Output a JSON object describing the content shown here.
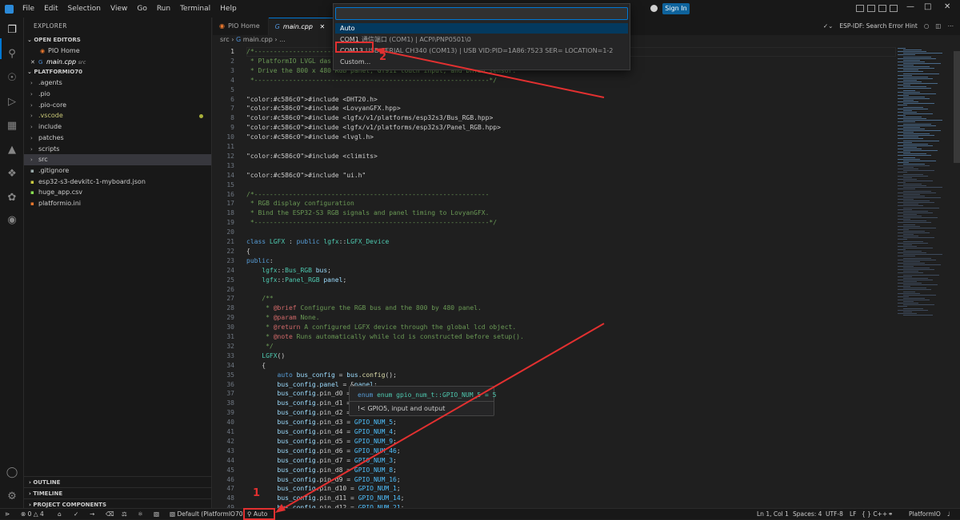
{
  "menu": [
    "File",
    "Edit",
    "Selection",
    "View",
    "Go",
    "Run",
    "Terminal",
    "Help"
  ],
  "signin_label": "Sign In",
  "activity_icons": [
    "files-icon",
    "search-icon",
    "source-control-icon",
    "run-debug-icon",
    "extensions-icon",
    "testing-icon",
    "python-icon",
    "remote-icon",
    "platformio-icon"
  ],
  "explorer": {
    "title": "EXPLORER",
    "open_editors": "OPEN EDITORS",
    "open_files": [
      {
        "name": "PIO Home",
        "note": ""
      },
      {
        "name": "main.cpp",
        "note": "src"
      }
    ],
    "project": "PLATFORMIO70",
    "tree": [
      {
        "name": ".agents",
        "kind": "folder"
      },
      {
        "name": ".pio",
        "kind": "folder"
      },
      {
        "name": ".pio-core",
        "kind": "folder"
      },
      {
        "name": ".vscode",
        "kind": "folder"
      },
      {
        "name": "include",
        "kind": "folder"
      },
      {
        "name": "patches",
        "kind": "folder"
      },
      {
        "name": "scripts",
        "kind": "folder"
      },
      {
        "name": "src",
        "kind": "folder"
      },
      {
        "name": ".gitignore",
        "kind": "file"
      },
      {
        "name": "esp32-s3-devkitc-1-myboard.json",
        "kind": "file"
      },
      {
        "name": "huge_app.csv",
        "kind": "file"
      },
      {
        "name": "platformio.ini",
        "kind": "file"
      }
    ],
    "outline": "OUTLINE",
    "timeline": "TIMELINE",
    "project_components": "PROJECT COMPONENTS"
  },
  "tabs": [
    {
      "label": "PIO Home"
    },
    {
      "label": "main.cpp"
    }
  ],
  "tab_right": "ESP-IDF: Search Error Hint",
  "breadcrumb": [
    "src",
    "main.cpp",
    "..."
  ],
  "palette": {
    "input_value": "",
    "items": [
      {
        "label": "Auto",
        "desc": ""
      },
      {
        "label": "COM1",
        "desc": "通信端口 (COM1) | ACPI\\PNP0501\\0"
      },
      {
        "label": "COM13",
        "desc": "USB-SERIAL CH340 (COM13) | USB VID:PID=1A86:7523 SER= LOCATION=1-2"
      },
      {
        "label": "Custom...",
        "desc": ""
      }
    ]
  },
  "annotations": [
    "1",
    "2"
  ],
  "hover": {
    "signature": "enum gpio_num_t::GPIO_NUM_5 = 5",
    "doc": "!< GPIO5, input and output"
  },
  "code_lines": [
    {
      "n": "1",
      "t": "/*-------------------------------------------------------------"
    },
    {
      "n": "2",
      "t": " * PlatformIO LVGL das"
    },
    {
      "n": "3",
      "t": " * Drive the 800 x 480 RGB panel, GT911 touch input, and DHT20 sensor."
    },
    {
      "n": "4",
      "t": " *-------------------------------------------------------------*/"
    },
    {
      "n": "5",
      "t": ""
    },
    {
      "n": "6",
      "t": "#include <DHT20.h>"
    },
    {
      "n": "7",
      "t": "#include <LovyanGFX.hpp>"
    },
    {
      "n": "8",
      "t": "#include <lgfx/v1/platforms/esp32s3/Bus_RGB.hpp>"
    },
    {
      "n": "9",
      "t": "#include <lgfx/v1/platforms/esp32s3/Panel_RGB.hpp>"
    },
    {
      "n": "10",
      "t": "#include <lvgl.h>"
    },
    {
      "n": "11",
      "t": ""
    },
    {
      "n": "12",
      "t": "#include <climits>"
    },
    {
      "n": "13",
      "t": ""
    },
    {
      "n": "14",
      "t": "#include \"ui.h\""
    },
    {
      "n": "15",
      "t": ""
    },
    {
      "n": "16",
      "t": "/*-------------------------------------------------------------"
    },
    {
      "n": "17",
      "t": " * RGB display configuration"
    },
    {
      "n": "18",
      "t": " * Bind the ESP32-S3 RGB signals and panel timing to LovyanGFX."
    },
    {
      "n": "19",
      "t": " *-------------------------------------------------------------*/"
    },
    {
      "n": "20",
      "t": ""
    },
    {
      "n": "21",
      "t": "class LGFX : public lgfx::LGFX_Device"
    },
    {
      "n": "22",
      "t": "{"
    },
    {
      "n": "23",
      "t": "public:"
    },
    {
      "n": "24",
      "t": "    lgfx::Bus_RGB bus;"
    },
    {
      "n": "25",
      "t": "    lgfx::Panel_RGB panel;"
    },
    {
      "n": "26",
      "t": ""
    },
    {
      "n": "27",
      "t": "    /**"
    },
    {
      "n": "28",
      "t": "     * @brief Configure the RGB bus and the 800 by 480 panel."
    },
    {
      "n": "29",
      "t": "     * @param None."
    },
    {
      "n": "30",
      "t": "     * @return A configured LGFX device through the global lcd object."
    },
    {
      "n": "31",
      "t": "     * @note Runs automatically while lcd is constructed before setup()."
    },
    {
      "n": "32",
      "t": "     */"
    },
    {
      "n": "33",
      "t": "    LGFX()"
    },
    {
      "n": "34",
      "t": "    {"
    },
    {
      "n": "35",
      "t": "        auto bus_config = bus.config();"
    },
    {
      "n": "36",
      "t": "        bus_config.panel = &panel;"
    },
    {
      "n": "37",
      "t": "        bus_config.pin_d0 = "
    },
    {
      "n": "38",
      "t": "        bus_config.pin_d1 = "
    },
    {
      "n": "39",
      "t": "        bus_config.pin_d2 = "
    },
    {
      "n": "40",
      "t": "        bus_config.pin_d3 = GPIO_NUM_5;"
    },
    {
      "n": "41",
      "t": "        bus_config.pin_d4 = GPIO_NUM_4;"
    },
    {
      "n": "42",
      "t": "        bus_config.pin_d5 = GPIO_NUM_9;"
    },
    {
      "n": "43",
      "t": "        bus_config.pin_d6 = GPIO_NUM_46;"
    },
    {
      "n": "44",
      "t": "        bus_config.pin_d7 = GPIO_NUM_3;"
    },
    {
      "n": "45",
      "t": "        bus_config.pin_d8 = GPIO_NUM_8;"
    },
    {
      "n": "46",
      "t": "        bus_config.pin_d9 = GPIO_NUM_16;"
    },
    {
      "n": "47",
      "t": "        bus_config.pin_d10 = GPIO_NUM_1;"
    },
    {
      "n": "48",
      "t": "        bus_config.pin_d11 = GPIO_NUM_14;"
    },
    {
      "n": "49",
      "t": "        bus_config.pin_d12 = GPIO_NUM_21;"
    }
  ],
  "status": {
    "errors": "0",
    "warnings": "4",
    "env": "Default (PlatformIO70)",
    "port": "Auto",
    "position": "Ln 1, Col 1",
    "spaces": "Spaces: 4",
    "encoding": "UTF-8",
    "eol": "LF",
    "language": "C++",
    "platformio": "PlatformIO"
  },
  "colors": {
    "accent": "#0078d4",
    "annotation": "#e23030",
    "selection": "#04395e"
  }
}
